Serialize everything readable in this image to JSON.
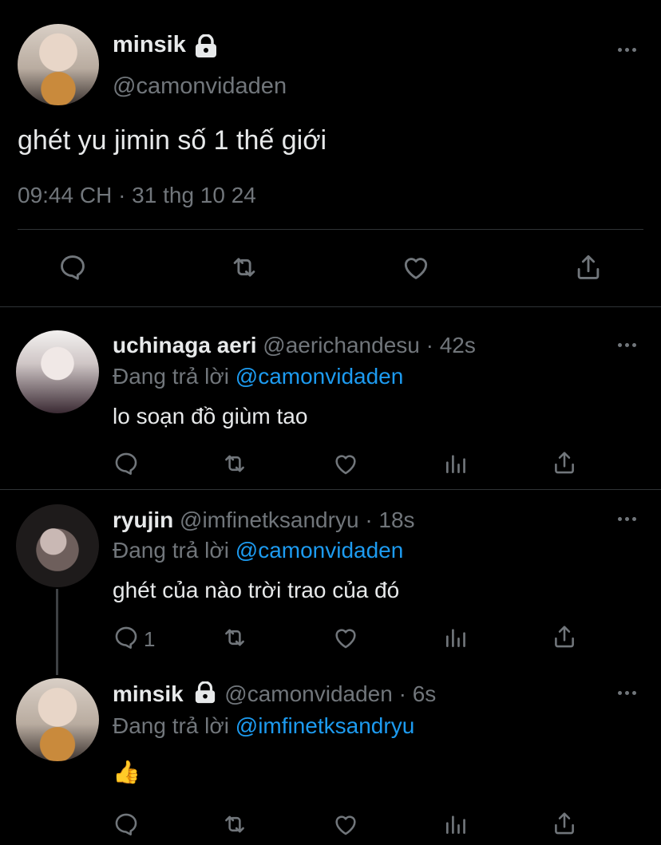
{
  "main_tweet": {
    "name": "minsik",
    "handle": "@camonvidaden",
    "text": "ghét yu jimin số 1 thế giới",
    "timestamp": "09:44 CH · 31 thg 10 24"
  },
  "replies": [
    {
      "name": "uchinaga aeri",
      "handle": "@aerichandesu",
      "age": "· 42s",
      "replying_label": "Đang trả lời",
      "replying_to": "@camonvidaden",
      "text": "lo soạn đồ  giùm tao"
    },
    {
      "name": "ryujin",
      "handle": "@imfinetksandryu",
      "age": "· 18s",
      "replying_label": "Đang trả lời",
      "replying_to": "@camonvidaden",
      "text": "ghét của nào trời trao của đó",
      "reply_count": "1"
    },
    {
      "name": "minsik",
      "handle": "@camonvidaden",
      "age": "· 6s",
      "replying_label": "Đang trả lời",
      "replying_to": "@imfinetksandryu",
      "text": "👍"
    }
  ],
  "colors": {
    "background": "#000000",
    "text": "#e7e9ea",
    "muted": "#71767b",
    "link": "#1d9bf0",
    "divider": "#2f3336"
  }
}
